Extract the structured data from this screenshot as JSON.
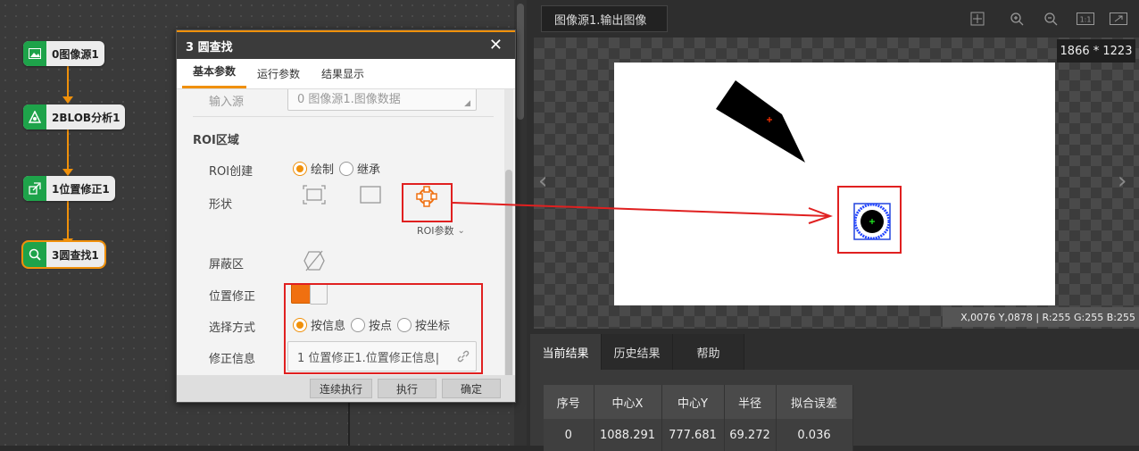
{
  "flow": {
    "nodes": [
      {
        "label": "0图像源1",
        "icon": "image-icon"
      },
      {
        "label": "2BLOB分析1",
        "icon": "blob-icon"
      },
      {
        "label": "1位置修正1",
        "icon": "position-correct-icon"
      },
      {
        "label": "3圆查找1",
        "icon": "circle-find-icon"
      }
    ],
    "accent": "#f0900a",
    "node_icon_color": "#1ea34a"
  },
  "dialog": {
    "title": "3 圆查找",
    "close": "✕",
    "tabs": [
      "基本参数",
      "运行参数",
      "结果显示"
    ],
    "input_source_label": "输入源",
    "input_source_value": "0 图像源1.图像数据",
    "roi_section": "ROI区域",
    "roi_create_label": "ROI创建",
    "roi_create_options": [
      "绘制",
      "继承"
    ],
    "shape_label": "形状",
    "roi_params": "ROI参数",
    "mask_label": "屏蔽区",
    "position_correct_label": "位置修正",
    "select_mode_label": "选择方式",
    "select_mode_options": [
      "按信息",
      "按点",
      "按坐标"
    ],
    "correct_info_label": "修正信息",
    "correct_info_value": "1 位置修正1.位置修正信息|",
    "buttons": [
      "连续执行",
      "执行",
      "确定"
    ]
  },
  "viewer": {
    "tab": "图像源1.输出图像",
    "size": "1866 * 1223",
    "pixel_info": "X,0076  Y,0878  |  R:255  G:255  B:255",
    "toolbar_icons": [
      "fit-icon",
      "zoom-in-icon",
      "zoom-out-icon",
      "actual-size-icon",
      "fullscreen-icon"
    ]
  },
  "results": {
    "tabs": [
      "当前结果",
      "历史结果",
      "帮助"
    ],
    "columns": [
      "序号",
      "中心X",
      "中心Y",
      "半径",
      "拟合误差"
    ],
    "rows": [
      [
        "0",
        "1088.291",
        "777.681",
        "69.272",
        "0.036"
      ]
    ]
  }
}
